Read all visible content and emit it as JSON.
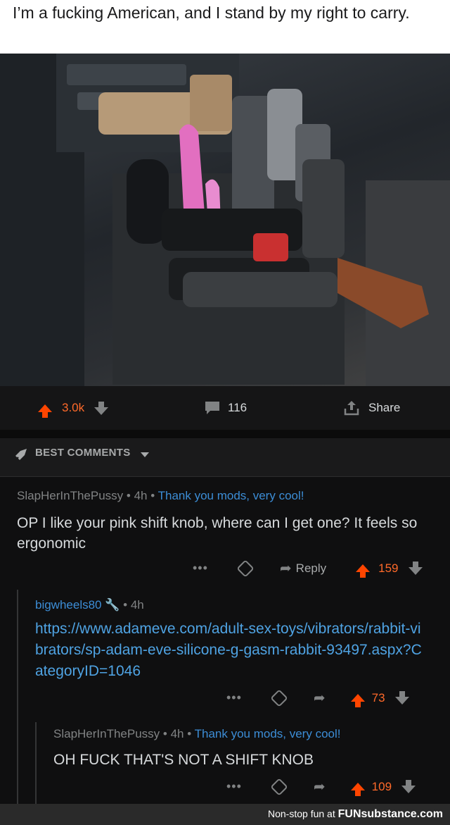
{
  "meme_caption": "I’m a fucking American, and I stand by my right to carry.",
  "post_bar": {
    "upvotes": "3.0k",
    "comments": "116",
    "share_label": "Share"
  },
  "sort": {
    "label": "BEST COMMENTS"
  },
  "comments": [
    {
      "author": "SlapHerInThePussy",
      "age": "4h",
      "flair": "Thank you mods, very cool!",
      "body": "OP I like your pink shift knob, where can I get one? It feels so ergonomic",
      "reply_label": "Reply",
      "score": "159"
    },
    {
      "author": "bigwheels80",
      "age": "4h",
      "body": "https://www.adameve.com/adult-sex-toys/vibrators/rabbit-vibrators/sp-adam-eve-silicone-g-gasm-rabbit-93497.aspx?CategoryID=1046",
      "score": "73"
    },
    {
      "author": "SlapHerInThePussy",
      "age": "4h",
      "flair": "Thank you mods, very cool!",
      "body": "OH FUCK THAT'S NOT A SHIFT KNOB",
      "score": "109"
    }
  ],
  "footer": {
    "tagline": "Non-stop fun at",
    "brand": "FUNsubstance.com"
  },
  "colors": {
    "upvote": "#ff4500",
    "link": "#4fa3e3",
    "flair": "#3c8dd6"
  }
}
